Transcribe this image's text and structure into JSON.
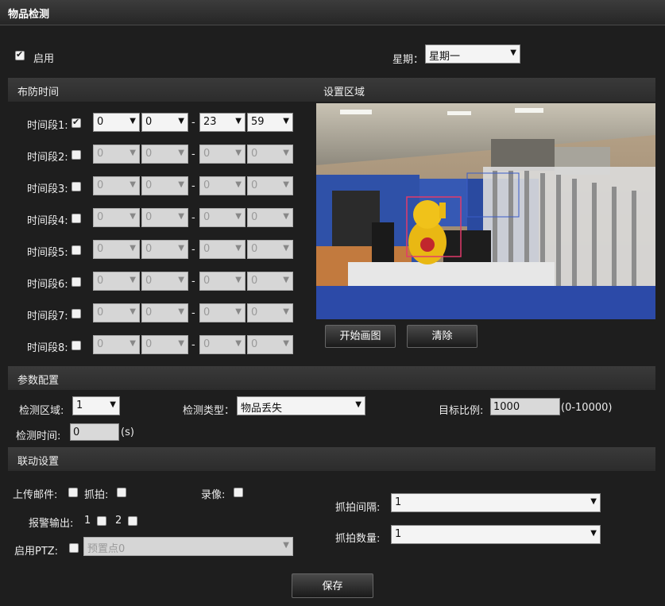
{
  "title": "物品检测",
  "enable": {
    "label": "启用",
    "checked": true
  },
  "week": {
    "label": "星期：",
    "value": "星期一"
  },
  "schedule": {
    "header": "布防时间",
    "slots": [
      {
        "label": "时间段1:",
        "checked": true,
        "h1": "0",
        "m1": "0",
        "h2": "23",
        "m2": "59"
      },
      {
        "label": "时间段2:",
        "checked": false,
        "h1": "0",
        "m1": "0",
        "h2": "0",
        "m2": "0"
      },
      {
        "label": "时间段3:",
        "checked": false,
        "h1": "0",
        "m1": "0",
        "h2": "0",
        "m2": "0"
      },
      {
        "label": "时间段4:",
        "checked": false,
        "h1": "0",
        "m1": "0",
        "h2": "0",
        "m2": "0"
      },
      {
        "label": "时间段5:",
        "checked": false,
        "h1": "0",
        "m1": "0",
        "h2": "0",
        "m2": "0"
      },
      {
        "label": "时间段6:",
        "checked": false,
        "h1": "0",
        "m1": "0",
        "h2": "0",
        "m2": "0"
      },
      {
        "label": "时间段7:",
        "checked": false,
        "h1": "0",
        "m1": "0",
        "h2": "0",
        "m2": "0"
      },
      {
        "label": "时间段8:",
        "checked": false,
        "h1": "0",
        "m1": "0",
        "h2": "0",
        "m2": "0"
      }
    ],
    "dash": "-"
  },
  "area": {
    "header": "设置区域",
    "start_btn": "开始画图",
    "clear_btn": "清除"
  },
  "params": {
    "header": "参数配置",
    "region_label": "检测区域:",
    "region_value": "1",
    "type_label": "检测类型：",
    "type_value": "物品丢失",
    "ratio_label": "目标比例:",
    "ratio_value": "1000",
    "ratio_range": "(0-10000)",
    "time_label": "检测时间:",
    "time_value": "0",
    "time_unit": "(s)"
  },
  "linkage": {
    "header": "联动设置",
    "email_label": "上传邮件:",
    "snap_label": "抓拍:",
    "record_label": "录像:",
    "alarm_label": "报警输出:",
    "alarm1": "1",
    "alarm2": "2",
    "ptz_label": "启用PTZ:",
    "ptz_value": "预置点0",
    "interval_label": "抓拍间隔:",
    "interval_value": "1",
    "count_label": "抓拍数量:",
    "count_value": "1"
  },
  "save_btn": "保存",
  "colors": {
    "bg": "#1e1e1e",
    "section": "#333333",
    "roi": "#e23a6a"
  }
}
